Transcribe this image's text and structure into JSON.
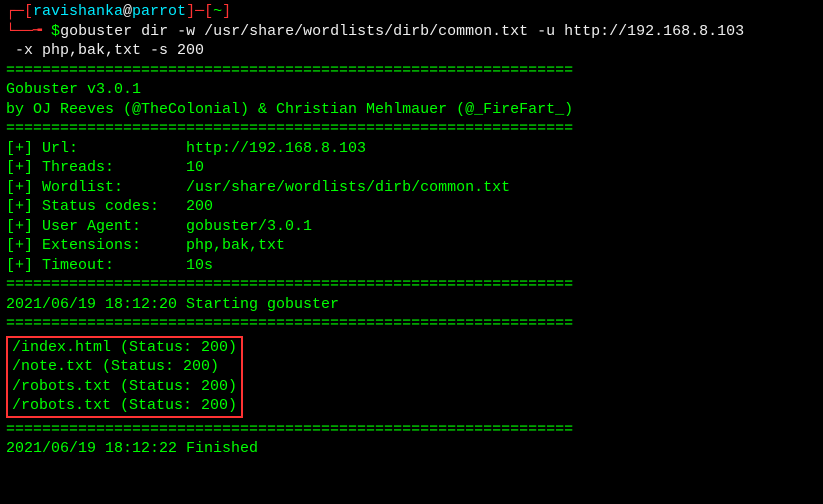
{
  "prompt": {
    "bracket_open": "┌─[",
    "user": "ravishanka",
    "at": "@",
    "host": "parrot",
    "bracket_close": "]─[",
    "path": "~",
    "bracket_end": "]",
    "arrow": "└──╼ ",
    "dollar": "$",
    "command": "gobuster dir -w /usr/share/wordlists/dirb/common.txt -u http://192.168.8.103",
    "command_cont": " -x php,bak,txt -s 200"
  },
  "divider": "===============================================================",
  "header": {
    "title": "Gobuster v3.0.1",
    "byline": "by OJ Reeves (@TheColonial) & Christian Mehlmauer (@_FireFart_)"
  },
  "settings": [
    {
      "label": "[+] Url:            ",
      "value": "http://192.168.8.103"
    },
    {
      "label": "[+] Threads:        ",
      "value": "10"
    },
    {
      "label": "[+] Wordlist:       ",
      "value": "/usr/share/wordlists/dirb/common.txt"
    },
    {
      "label": "[+] Status codes:   ",
      "value": "200"
    },
    {
      "label": "[+] User Agent:     ",
      "value": "gobuster/3.0.1"
    },
    {
      "label": "[+] Extensions:     ",
      "value": "php,bak,txt"
    },
    {
      "label": "[+] Timeout:        ",
      "value": "10s"
    }
  ],
  "start_line": "2021/06/19 18:12:20 Starting gobuster",
  "results": [
    "/index.html (Status: 200)",
    "/note.txt (Status: 200)",
    "/robots.txt (Status: 200)",
    "/robots.txt (Status: 200)"
  ],
  "finish_line": "2021/06/19 18:12:22 Finished"
}
